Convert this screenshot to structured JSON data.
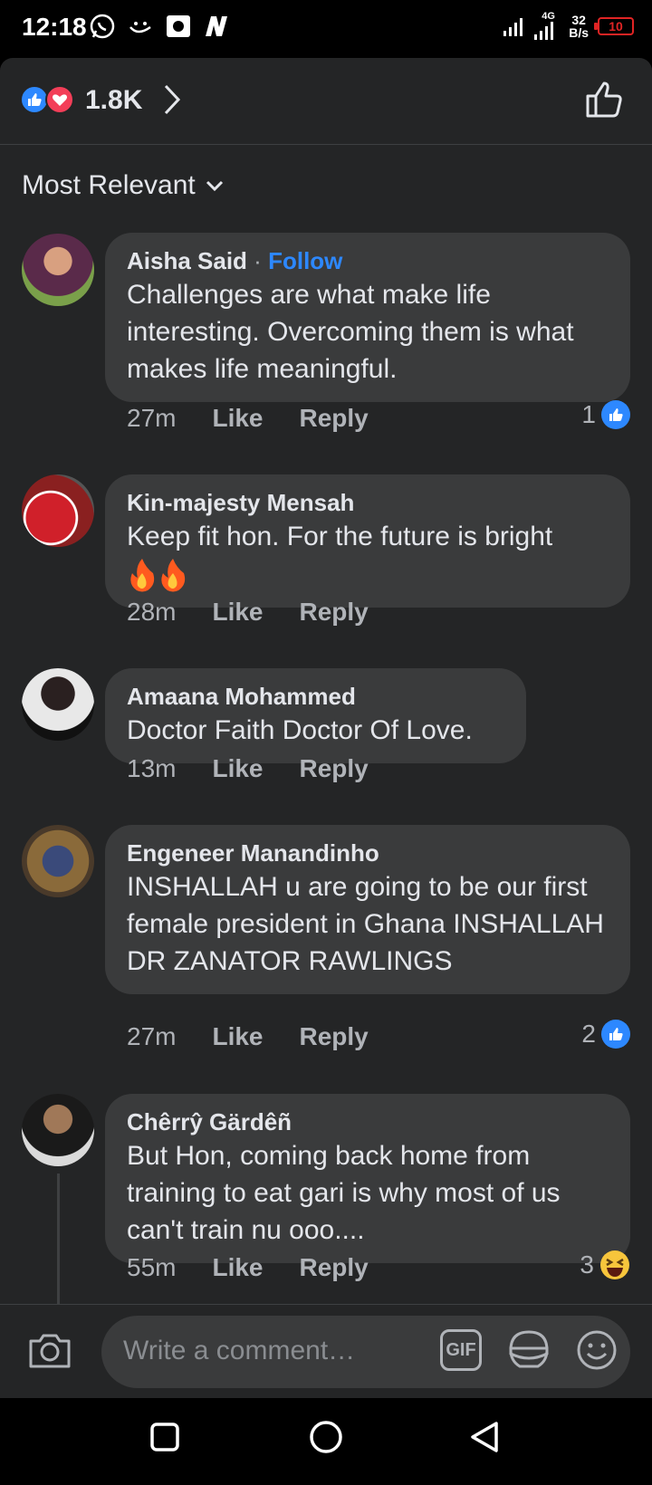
{
  "status_bar": {
    "time": "12:18",
    "network_type": "4G",
    "speed_value": "32",
    "speed_unit": "B/s",
    "battery": "10"
  },
  "reactions": {
    "count": "1.8K",
    "icons": [
      "like-icon",
      "heart-icon"
    ]
  },
  "sort": {
    "label": "Most Relevant"
  },
  "comments": [
    {
      "author": "Aisha Said",
      "follow_label": "Follow",
      "text": "Challenges are what make life interesting. Overcoming them is what makes life meaningful.",
      "time": "27m",
      "like_label": "Like",
      "reply_label": "Reply",
      "reaction_count": "1",
      "reaction_icon": "like-icon"
    },
    {
      "author": "Kin-majesty Mensah",
      "text": "Keep fit hon. For the future is bright",
      "emoji": "fire-emoji fire-emoji",
      "time": "28m",
      "like_label": "Like",
      "reply_label": "Reply"
    },
    {
      "author": "Amaana Mohammed",
      "text": "Doctor Faith Doctor Of Love.",
      "time": "13m",
      "like_label": "Like",
      "reply_label": "Reply"
    },
    {
      "author": "Engeneer Manandinho",
      "text": "INSHALLAH u are going to be our first female president in Ghana INSHALLAH DR ZANATOR RAWLINGS",
      "time": "27m",
      "like_label": "Like",
      "reply_label": "Reply",
      "reaction_count": "2",
      "reaction_icon": "like-icon"
    },
    {
      "author": "Chêrrŷ Gärdêñ",
      "text": "But Hon, coming back home from training to eat gari is why most of us can't train nu ooo....",
      "time": "55m",
      "like_label": "Like",
      "reply_label": "Reply",
      "reaction_count": "3",
      "reaction_icon": "laughing-emoji"
    }
  ],
  "composer": {
    "placeholder": "Write a comment…",
    "gif_label": "GIF"
  },
  "colors": {
    "background": "#242526",
    "bubble": "#3a3b3c",
    "accent": "#2d88ff",
    "text_primary": "#e4e6eb",
    "text_secondary": "#b0b3b8"
  }
}
